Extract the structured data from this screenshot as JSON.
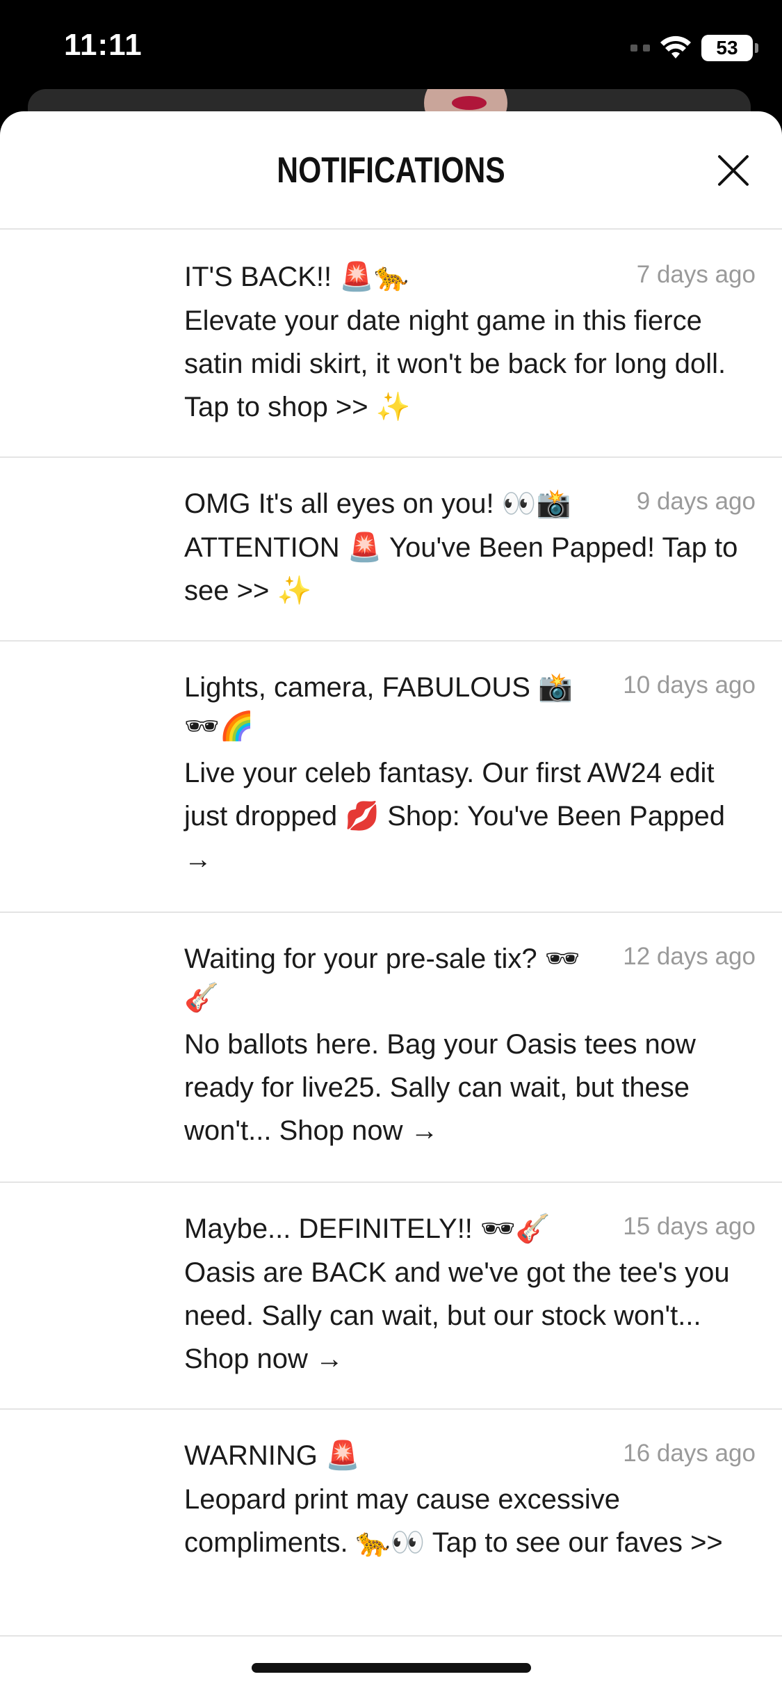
{
  "status": {
    "time": "11:11",
    "battery": "53"
  },
  "header": {
    "title": "NOTIFICATIONS",
    "close_icon": "close-icon"
  },
  "notifications": [
    {
      "title": "IT'S BACK!! 🚨🐆",
      "time": "7 days ago",
      "body": "Elevate your date night game in this fierce satin midi skirt, it won't be back for long doll. Tap to shop >> ✨"
    },
    {
      "title": "OMG It's all eyes on you! 👀📸",
      "time": "9 days ago",
      "body": "ATTENTION 🚨 You've Been Papped! Tap to see >> ✨"
    },
    {
      "title": "Lights, camera, FABULOUS 📸 🕶🌈",
      "time": "10 days ago",
      "body": "Live your celeb fantasy. Our first AW24 edit just dropped 💋 Shop: You've Been Papped →"
    },
    {
      "title": "Waiting for your pre-sale tix? 🕶🎸",
      "time": "12 days ago",
      "body": "No ballots here. Bag your Oasis tees now ready for live25. Sally can wait, but these won't... Shop now →"
    },
    {
      "title": "Maybe... DEFINITELY!! 🕶🎸",
      "time": "15 days ago",
      "body": "Oasis are BACK and we've got the tee's you need. Sally can wait, but our stock won't... Shop now →"
    },
    {
      "title": "WARNING 🚨",
      "time": "16 days ago",
      "body": "Leopard print may cause excessive compliments. 🐆👀 Tap to see our faves >>"
    }
  ]
}
